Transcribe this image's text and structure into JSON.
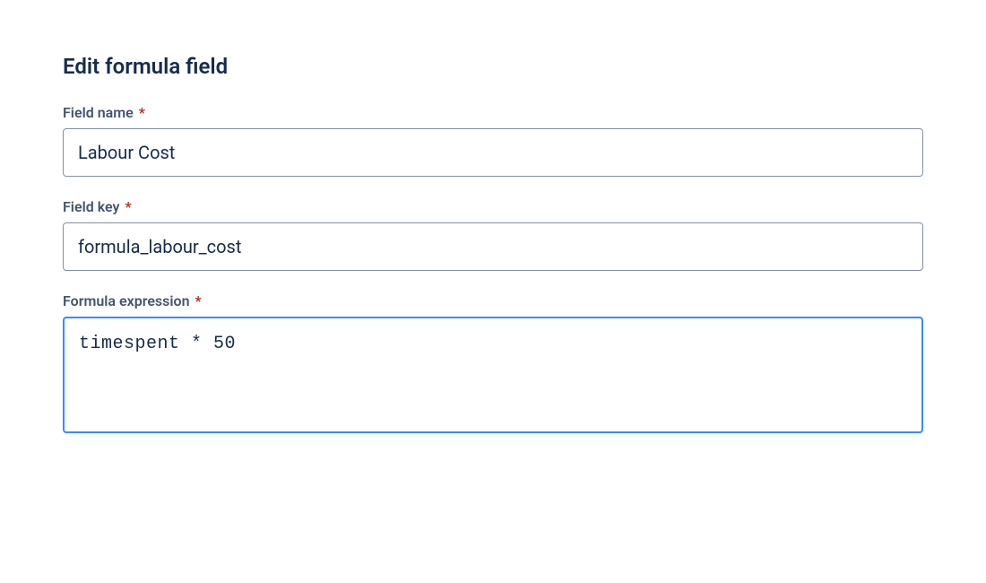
{
  "title": "Edit formula field",
  "fields": {
    "name": {
      "label": "Field name",
      "value": "Labour Cost"
    },
    "key": {
      "label": "Field key",
      "value": "formula_labour_cost"
    },
    "expression": {
      "label": "Formula expression",
      "value": "timespent * 50"
    }
  },
  "required_marker": "*"
}
